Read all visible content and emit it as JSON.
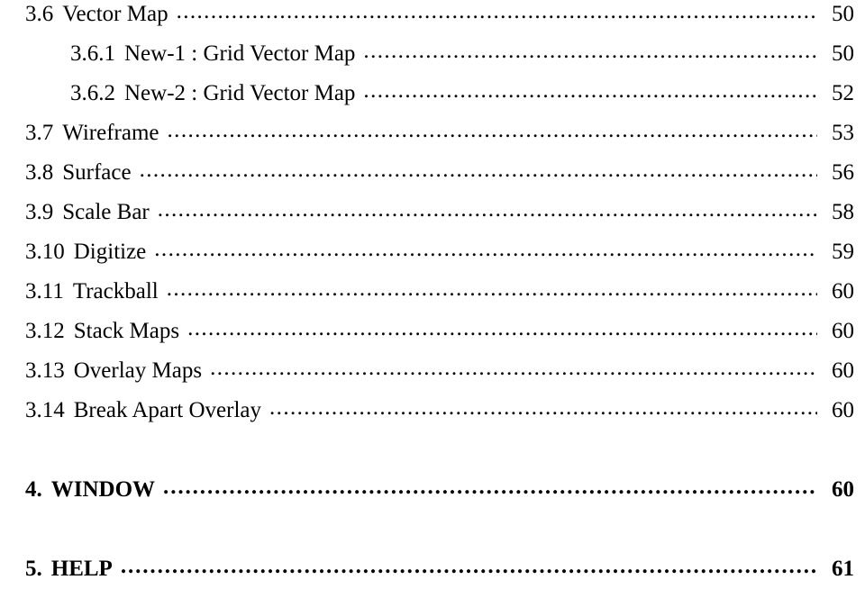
{
  "document": {
    "type": "table-of-contents",
    "background_color": "#ffffff",
    "text_color": "#000000",
    "entries": [
      {
        "number": "3.6",
        "label": "Vector Map",
        "page": "50",
        "level": 1,
        "style": "normal"
      },
      {
        "number": "3.6.1",
        "label": "New-1 : Grid Vector Map",
        "page": "50",
        "level": 2,
        "style": "normal"
      },
      {
        "number": "3.6.2",
        "label": "New-2 : Grid Vector Map",
        "page": "52",
        "level": 2,
        "style": "normal"
      },
      {
        "number": "3.7",
        "label": "Wireframe",
        "page": "53",
        "level": 1,
        "style": "normal"
      },
      {
        "number": "3.8",
        "label": "Surface",
        "page": "56",
        "level": 1,
        "style": "normal"
      },
      {
        "number": "3.9",
        "label": "Scale Bar",
        "page": "58",
        "level": 1,
        "style": "normal"
      },
      {
        "number": "3.10",
        "label": "Digitize",
        "page": "59",
        "level": 1,
        "style": "normal"
      },
      {
        "number": "3.11",
        "label": "Trackball",
        "page": "60",
        "level": 1,
        "style": "normal"
      },
      {
        "number": "3.12",
        "label": "Stack Maps",
        "page": "60",
        "level": 1,
        "style": "normal"
      },
      {
        "number": "3.13",
        "label": "Overlay Maps",
        "page": "60",
        "level": 1,
        "style": "normal"
      },
      {
        "number": "3.14",
        "label": "Break Apart Overlay",
        "page": "60",
        "level": 1,
        "style": "normal"
      },
      {
        "number": "4.",
        "label": "WINDOW",
        "page": "60",
        "level": 1,
        "style": "section"
      },
      {
        "number": "5.",
        "label": "HELP",
        "page": "61",
        "level": 1,
        "style": "section"
      }
    ]
  }
}
